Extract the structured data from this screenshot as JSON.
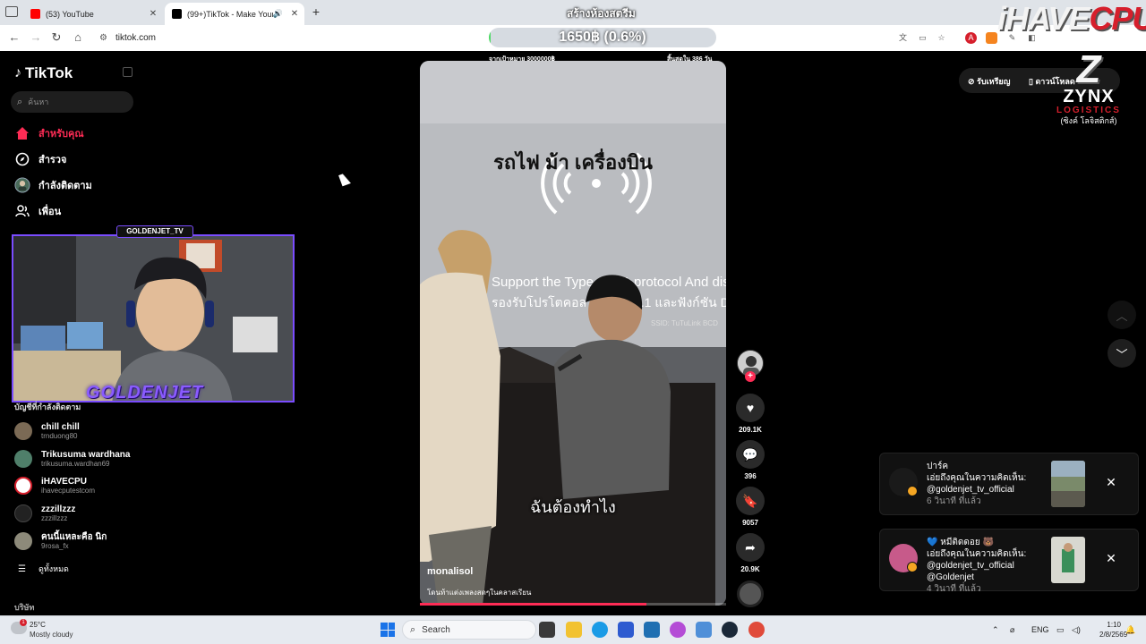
{
  "browser": {
    "tabs": [
      {
        "title": "(53) YouTube",
        "icon": "youtube-icon",
        "color": "#ff0000",
        "active": false
      },
      {
        "title": "(99+)TikTok - Make Your Da",
        "icon": "tiktok-icon",
        "color": "#000000",
        "active": true
      }
    ],
    "url": "tiktok.com",
    "new_tab_label": "+"
  },
  "stream_overlay": {
    "room_title": "สร้างห้องสตรีม",
    "goal_amount": "1650฿ (0.6%)",
    "goal_progress_percent": 0.6,
    "goal_left": "จากเป้าหมาย 3000000฿",
    "goal_right": "สิ้นสุดใน 386 วัน",
    "brand_main": "iHAVE",
    "brand_accent": "CPU",
    "webcam_tag": "GOLDENJET_TV",
    "webcam_name": "GOLDENJET",
    "sponsor": {
      "letter": "Z",
      "name": "ZYNX",
      "sub": "LOGISTICS",
      "thai": "(ซิงค์ โลจิสติกส์)"
    }
  },
  "tiktok": {
    "logo": "TikTok",
    "search_placeholder": "ค้นหา",
    "nav": [
      {
        "label": "สำหรับคุณ",
        "icon": "home-icon",
        "active": true
      },
      {
        "label": "สำรวจ",
        "icon": "compass-icon",
        "active": false
      },
      {
        "label": "กำลังติดตาม",
        "icon": "following-avatar-icon",
        "active": false
      },
      {
        "label": "เพื่อน",
        "icon": "friends-icon",
        "active": false
      }
    ],
    "following_title": "บัญชีที่กำลังติดตาม",
    "accounts": [
      {
        "name": "chill chill",
        "handle": "trnduong80"
      },
      {
        "name": "Trikusuma wardhana",
        "handle": "trikusuma.wardhan69"
      },
      {
        "name": "iHAVECPU",
        "handle": "ihavecputestcom"
      },
      {
        "name": "zzzillzzz",
        "handle": "zzzillzzz"
      },
      {
        "name": "คนนี้แหละคือ นิก",
        "handle": "9rosa_fx"
      }
    ],
    "see_all": "ดูทั้งหมด",
    "company": "บริษัท",
    "top_actions": {
      "coins": "รับเหรียญ",
      "download": "ดาวน์โหลด"
    }
  },
  "video": {
    "caption_top": "รถไฟ ม้า เครื่องบิน",
    "screen_text_1": "Support the Type-C 3.1 protocol And dis",
    "screen_text_2": "รองรับโปรโตคอล Type-C 3.1 และฟังก์ชัน Display",
    "screen_text_3": "SSID: TuTuLink  BCD",
    "subtitle": "ฉันต้องทำไง",
    "author": "monalisol",
    "description": "โดนท้าแต่งเพลงสดๆในคลาสเรียน",
    "progress": 0.74,
    "likes": "209.1K",
    "comments": "396",
    "saves": "9057",
    "shares": "20.9K"
  },
  "notifications": [
    {
      "user": "ปาร์ค",
      "message": "เอ่ยถึงคุณในความคิดเห็น: @goldenjet_tv_official",
      "time": "6 วินาที ที่แล้ว"
    },
    {
      "user": "💙 หมีติดดอย 🐻",
      "message": "เอ่ยถึงคุณในความคิดเห็น: @goldenjet_tv_official @Goldenjet",
      "time": "4 วินาที ที่แล้ว"
    }
  ],
  "taskbar": {
    "weather_temp": "25°C",
    "weather_cond": "Mostly cloudy",
    "weather_badge": "1",
    "search_label": "Search",
    "lang": "ENG",
    "time": "1:10",
    "date": "2/8/2569"
  }
}
